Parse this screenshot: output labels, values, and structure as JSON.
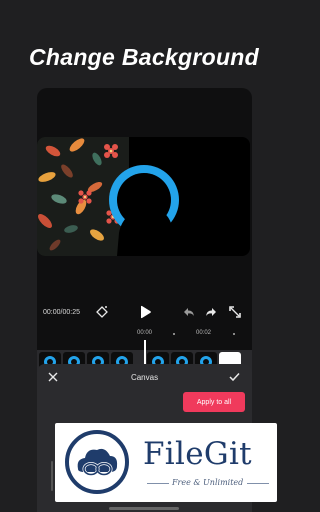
{
  "headline": "Change Background",
  "controls": {
    "timecode": "00:00/00:25",
    "keyframe_icon": "diamond-keyframe-icon",
    "play_icon": "play-icon",
    "undo_icon": "undo-icon",
    "redo_icon": "redo-icon",
    "fullscreen_icon": "fullscreen-icon"
  },
  "ruler": {
    "mark_a": "00:00",
    "mark_b": "00:02"
  },
  "sheet": {
    "title": "Canvas",
    "apply_label": "Apply to all",
    "close_icon": "close-icon",
    "confirm_icon": "check-icon"
  },
  "watermark": {
    "name": "FileGit",
    "tagline": "Free & Unlimited"
  },
  "colors": {
    "accent": "#f03a5c",
    "circle": "#23a3ea",
    "brand": "#1f3c6b"
  }
}
